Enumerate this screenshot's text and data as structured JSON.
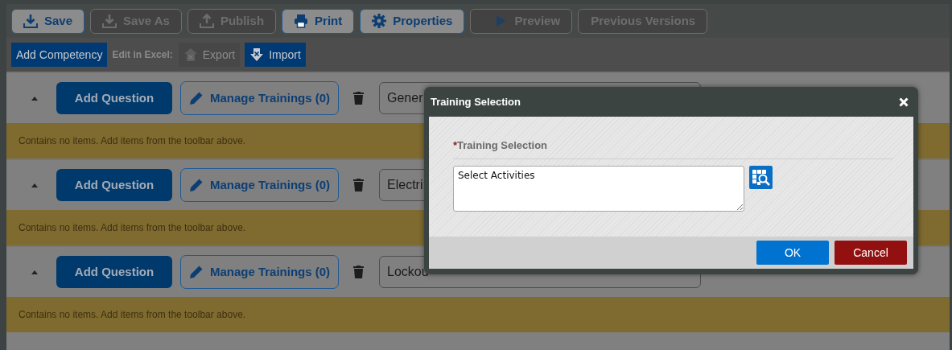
{
  "toolbar": {
    "buttons": [
      {
        "label": "Save",
        "disabled": false
      },
      {
        "label": "Save As",
        "disabled": true
      },
      {
        "label": "Publish",
        "disabled": true
      },
      {
        "label": "Print",
        "disabled": false
      },
      {
        "label": "Properties",
        "disabled": false
      },
      {
        "label": "Preview",
        "disabled": true
      },
      {
        "label": "Previous Versions",
        "disabled": true
      }
    ]
  },
  "secondary_toolbar": {
    "add_button": "Add Competency",
    "excel_label": "Edit in Excel:",
    "excel_buttons": [
      {
        "label": "Export",
        "disabled": true
      },
      {
        "label": "Import",
        "disabled": false
      }
    ]
  },
  "sections": [
    {
      "expanded": true,
      "add_button": "Add Question",
      "manage_button": "Manage Trainings (0)",
      "name_value": "Gener",
      "empty_message": "Contains no items. Add items from the toolbar above."
    },
    {
      "expanded": true,
      "add_button": "Add Question",
      "manage_button": "Manage Trainings (0)",
      "name_value": "Electri",
      "empty_message": "Contains no items. Add items from the toolbar above."
    },
    {
      "expanded": true,
      "add_button": "Add Question",
      "manage_button": "Manage Trainings (0)",
      "name_value": "Lockou",
      "empty_message": "Contains no items. Add items from the toolbar above."
    }
  ],
  "dialog": {
    "title": "Training Selection",
    "required_mark": "*",
    "field_label": "Training Selection",
    "field_value": "Select Activities",
    "buttons": [
      {
        "label": "OK",
        "kind": "primary"
      },
      {
        "label": "Cancel",
        "kind": "danger"
      }
    ]
  }
}
